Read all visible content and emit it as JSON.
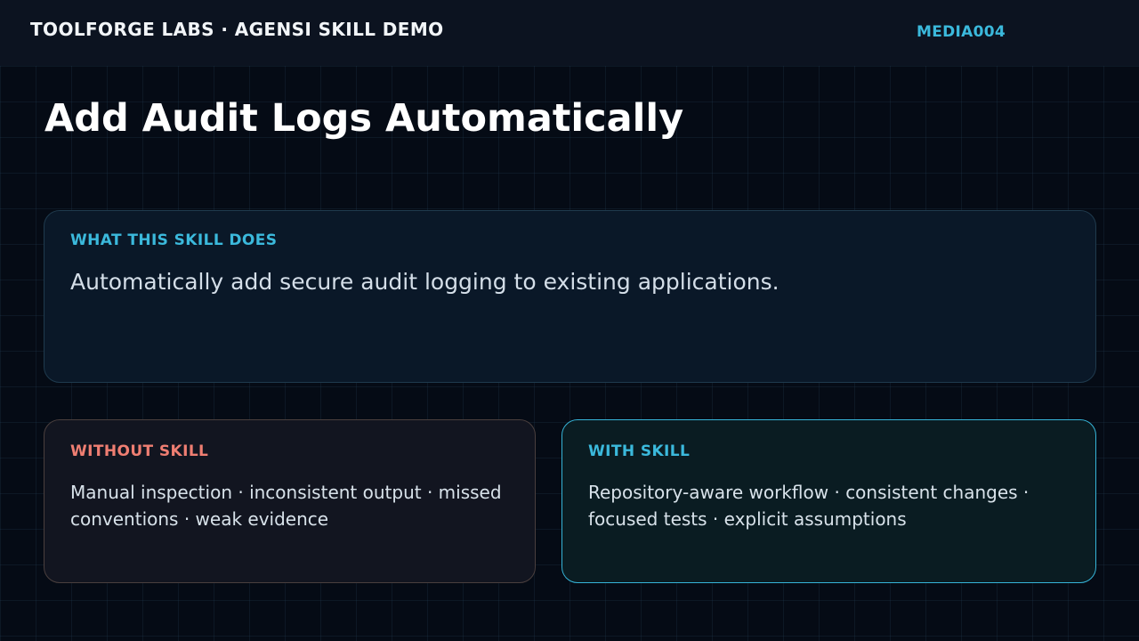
{
  "header": {
    "brand": "TOOLFORGE LABS · AGENSI SKILL DEMO",
    "media_id": "MEDIA004"
  },
  "title": "Add Audit Logs Automatically",
  "what_card": {
    "label": "WHAT THIS SKILL DOES",
    "text": "Automatically add secure audit logging to existing applications."
  },
  "without_card": {
    "label": "WITHOUT SKILL",
    "text": "Manual inspection · inconsistent output · missed conventions · weak evidence"
  },
  "with_card": {
    "label": "WITH SKILL",
    "text": "Repository-aware workflow · consistent changes · focused tests · explicit assumptions"
  },
  "colors": {
    "accent": "#3bb9dc",
    "warning": "#ef7e72",
    "background": "#050b15"
  }
}
